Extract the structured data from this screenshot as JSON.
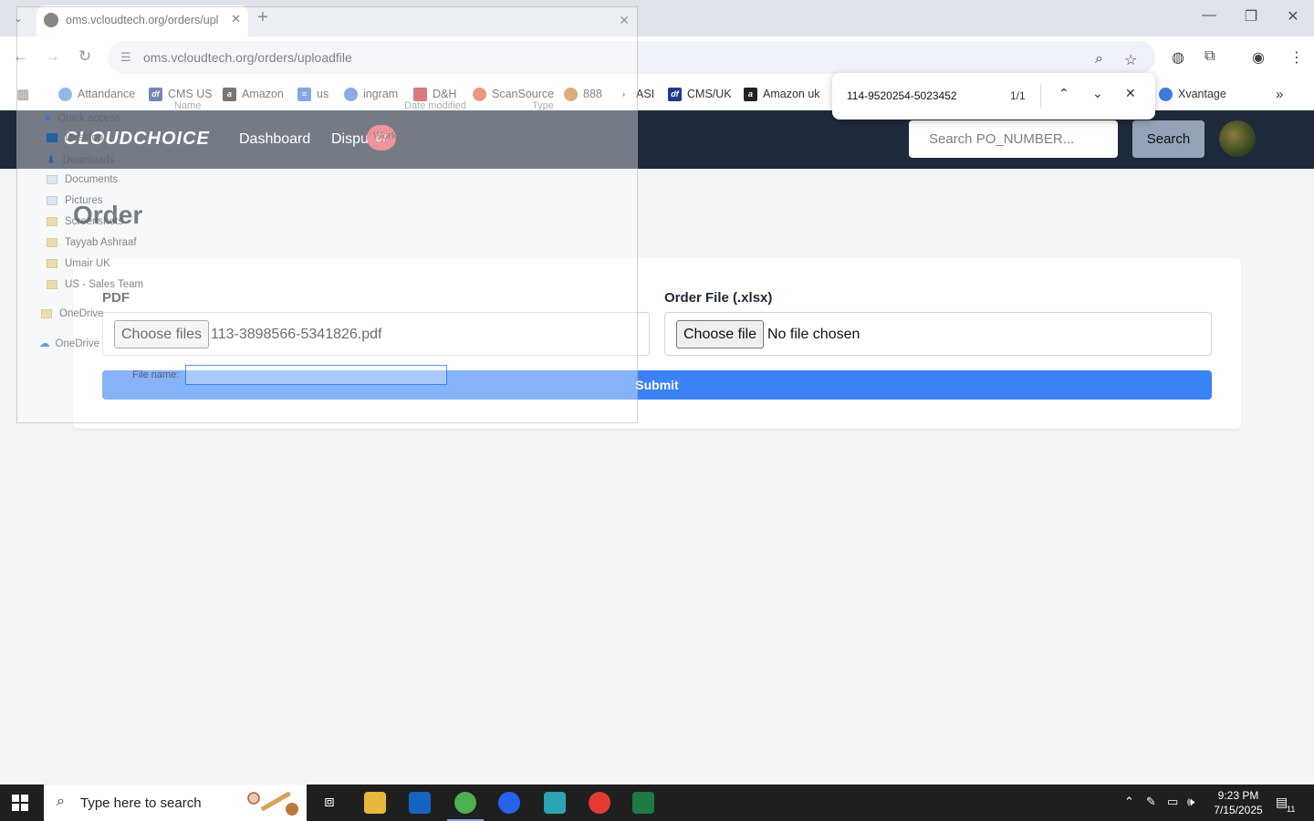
{
  "browser": {
    "tab_title": "oms.vcloudtech.org/orders/upl",
    "url": "oms.vcloudtech.org/orders/uploadfile",
    "bookmarks": [
      "Attandance",
      "CMS US",
      "Amazon",
      "us",
      "ingram",
      "D&H",
      "ScanSource",
      "888",
      "ASI",
      "CMS/UK",
      "Amazon uk",
      "Xvantage"
    ],
    "more_bookmarks": "»"
  },
  "find": {
    "query": "114-9520254-5023452",
    "count": "1/1"
  },
  "app": {
    "logo": "CLOUDCHOICE",
    "nav": {
      "dashboard": "Dashboard",
      "disputes": "Dispu"
    },
    "badge": "67",
    "search_placeholder": "Search PO_NUMBER...",
    "search_button": "Search"
  },
  "page": {
    "title": "Order",
    "pdf_label": "PDF",
    "pdf_button": "Choose files",
    "pdf_file": "113-3898566-5341826.pdf",
    "order_label": "Order File (.xlsx)",
    "order_button": "Choose file",
    "order_file": "No file chosen",
    "submit": "Submit"
  },
  "dialog": {
    "sidebar": [
      "Quick access",
      "Desktop",
      "Downloads",
      "Documents",
      "Pictures",
      "Screenshots",
      "Tayyab Ashraaf",
      "Umair UK",
      "US - Sales Team",
      "OneDrive",
      "OneDrive"
    ],
    "columns": [
      "Name",
      "Date modified",
      "Type"
    ],
    "status": "Working on it...",
    "file_name_label": "File name:"
  },
  "taskbar": {
    "search_placeholder": "Type here to search",
    "time": "9:23 PM",
    "date": "7/15/2025",
    "notifications": "11"
  }
}
